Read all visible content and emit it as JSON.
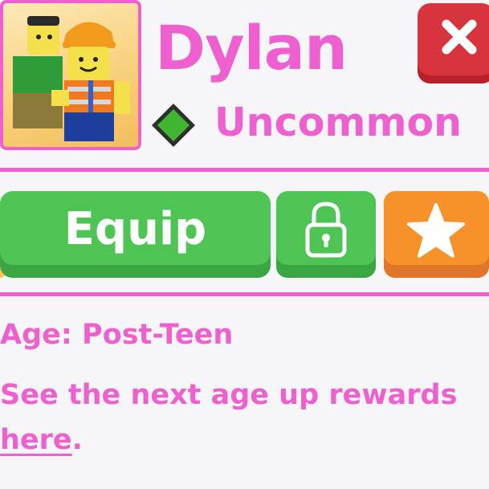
{
  "pet": {
    "name": "Dylan",
    "rarity": "Uncommon",
    "rarity_icon": "green-diamond-icon",
    "age_line": "Age: Post-Teen"
  },
  "actions": {
    "equip_label": "Equip",
    "lock_icon": "lock-icon",
    "favorite_icon": "star-icon",
    "close_icon": "close-icon"
  },
  "rewards": {
    "text": "See the next age up rewards ",
    "link_text": "here",
    "trailing": "."
  },
  "colors": {
    "accent_pink": "#ee5fcf",
    "equip_green": "#4ec455",
    "favorite_orange": "#f7922b",
    "close_red": "#d8343e",
    "rarity_green": "#3fb62f"
  }
}
